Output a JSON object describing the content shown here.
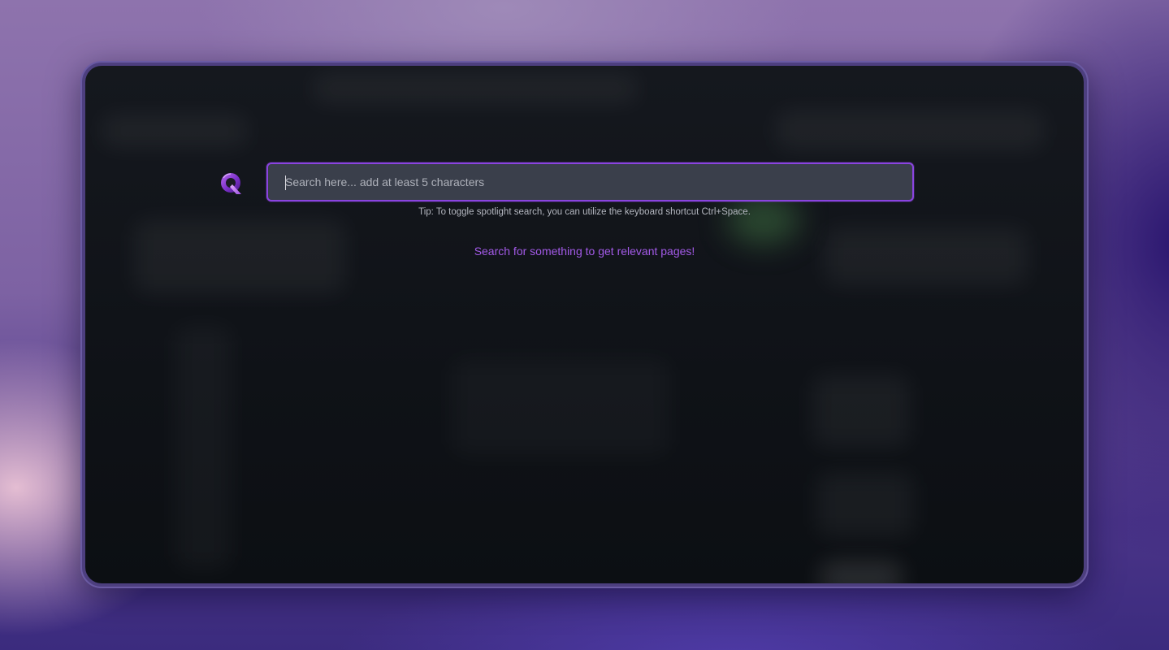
{
  "search": {
    "placeholder": "Search here... add at least 5 characters",
    "value": ""
  },
  "tip": "Tip: To toggle spotlight search, you can utilize the keyboard shortcut Ctrl+Space.",
  "empty_state": "Search for something to get relevant pages!",
  "logo": {
    "icon": "q-logo-icon"
  },
  "colors": {
    "accent": "#8a44e0",
    "accent_text": "#a35ae8",
    "input_bg": "#3a3f4b",
    "window_bg": "#111419"
  }
}
